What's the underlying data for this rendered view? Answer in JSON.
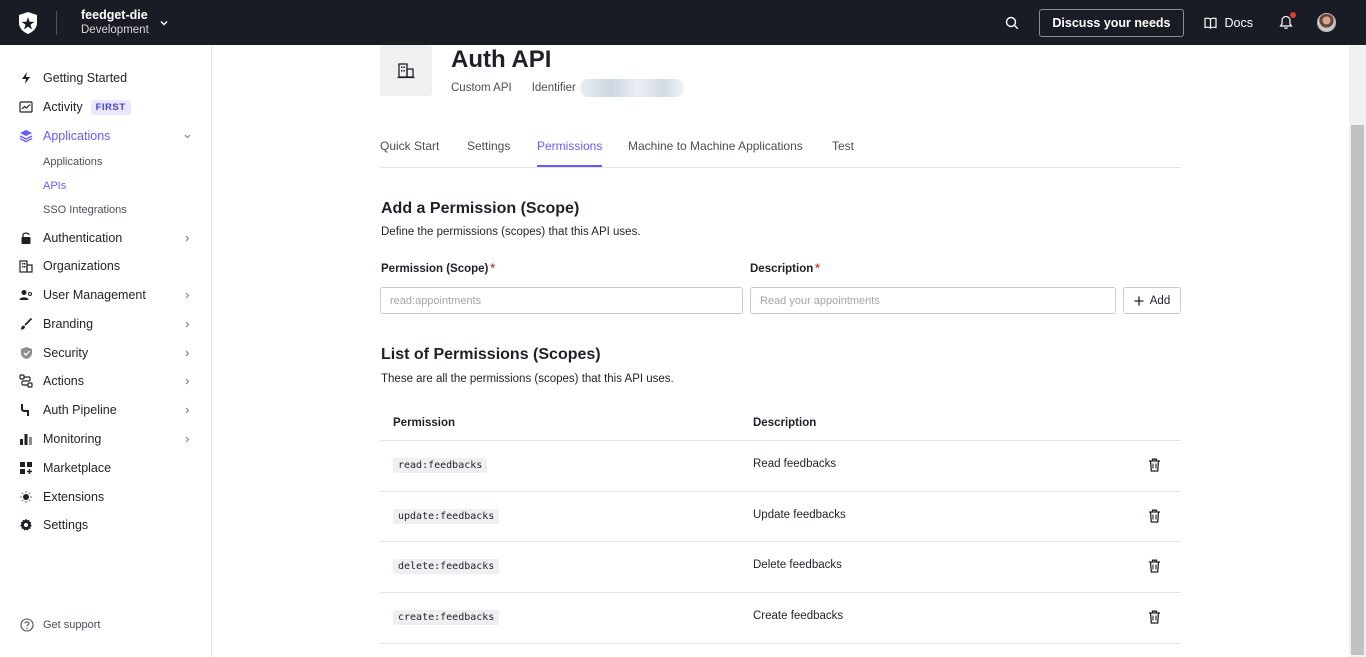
{
  "topbar": {
    "tenant_name": "feedget-die",
    "tenant_env": "Development",
    "discuss_label": "Discuss your needs",
    "docs_label": "Docs"
  },
  "sidebar": {
    "items": [
      {
        "label": "Getting Started",
        "icon": "bolt-icon"
      },
      {
        "label": "Activity",
        "icon": "activity-icon",
        "badge": "FIRST"
      },
      {
        "label": "Applications",
        "icon": "layers-icon",
        "active": true,
        "expanded": true
      },
      {
        "label": "Authentication",
        "icon": "lock-icon"
      },
      {
        "label": "Organizations",
        "icon": "building-icon"
      },
      {
        "label": "User Management",
        "icon": "users-icon"
      },
      {
        "label": "Branding",
        "icon": "brush-icon"
      },
      {
        "label": "Security",
        "icon": "shield-icon"
      },
      {
        "label": "Actions",
        "icon": "actions-icon"
      },
      {
        "label": "Auth Pipeline",
        "icon": "pipeline-icon"
      },
      {
        "label": "Monitoring",
        "icon": "bar-chart-icon"
      },
      {
        "label": "Marketplace",
        "icon": "grid-plus-icon"
      },
      {
        "label": "Extensions",
        "icon": "extensions-icon"
      },
      {
        "label": "Settings",
        "icon": "gear-icon"
      }
    ],
    "sub_items": [
      {
        "label": "Applications"
      },
      {
        "label": "APIs",
        "active": true
      },
      {
        "label": "SSO Integrations"
      }
    ],
    "support_label": "Get support"
  },
  "api": {
    "title": "Auth API",
    "type": "Custom API",
    "identifier_label": "Identifier"
  },
  "tabs": [
    {
      "label": "Quick Start"
    },
    {
      "label": "Settings"
    },
    {
      "label": "Permissions",
      "active": true
    },
    {
      "label": "Machine to Machine Applications"
    },
    {
      "label": "Test"
    }
  ],
  "add_permission": {
    "title": "Add a Permission (Scope)",
    "description": "Define the permissions (scopes) that this API uses.",
    "scope_label": "Permission (Scope)",
    "scope_placeholder": "read:appointments",
    "description_label": "Description",
    "description_placeholder": "Read your appointments",
    "required_mark": "*",
    "add_label": "Add"
  },
  "permissions_list": {
    "title": "List of Permissions (Scopes)",
    "description": "These are all the permissions (scopes) that this API uses.",
    "columns": [
      "Permission",
      "Description"
    ],
    "rows": [
      {
        "permission": "read:feedbacks",
        "description": "Read feedbacks"
      },
      {
        "permission": "update:feedbacks",
        "description": "Update feedbacks"
      },
      {
        "permission": "delete:feedbacks",
        "description": "Delete feedbacks"
      },
      {
        "permission": "create:feedbacks",
        "description": "Create feedbacks"
      }
    ]
  },
  "colors": {
    "topbar_bg": "#191c24",
    "accent": "#635dff",
    "required": "#d03c38"
  }
}
